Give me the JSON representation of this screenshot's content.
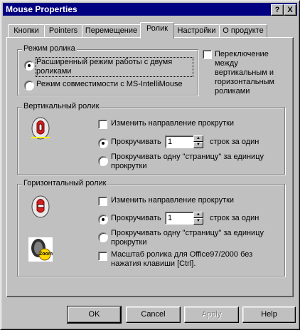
{
  "window": {
    "title": "Mouse Properties",
    "help_btn": "?",
    "close_btn": "X"
  },
  "tabs": [
    {
      "label": "Кнопки"
    },
    {
      "label": "Pointers"
    },
    {
      "label": "Перемещение"
    },
    {
      "label": "Ролик"
    },
    {
      "label": "Настройки"
    },
    {
      "label": "О продукте"
    }
  ],
  "wheel_mode": {
    "legend": "Режим ролика",
    "option1": "Расширенный режим работы с двумя роликами",
    "option2": "Режим совместимости с MS-IntelliMouse",
    "switch_label": "Переключение между вертикальным и горизонтальным роликами"
  },
  "vertical": {
    "legend": "Вертикальный ролик",
    "invert": "Изменить направление прокрутки",
    "scroll_label": "Прокручивать",
    "lines_value": "1",
    "lines_suffix": "строк за один",
    "page_label": "Прокручивать одну \"страницу\" за единицу прокрутки"
  },
  "horizontal": {
    "legend": "Горизонтальный ролик",
    "invert": "Изменить направление прокрутки",
    "scroll_label": "Прокручивать",
    "lines_value": "1",
    "lines_suffix": "строк за один",
    "page_label": "Прокручивать одну \"страницу\" за единицу прокрутки",
    "zoom_label": "Масштаб ролика для Office97/2000 без нажатия клавиши [Ctrl].",
    "zoom_icon_text": "Zoom"
  },
  "buttons": {
    "ok": "OK",
    "cancel": "Cancel",
    "apply": "Apply",
    "help": "Help"
  }
}
